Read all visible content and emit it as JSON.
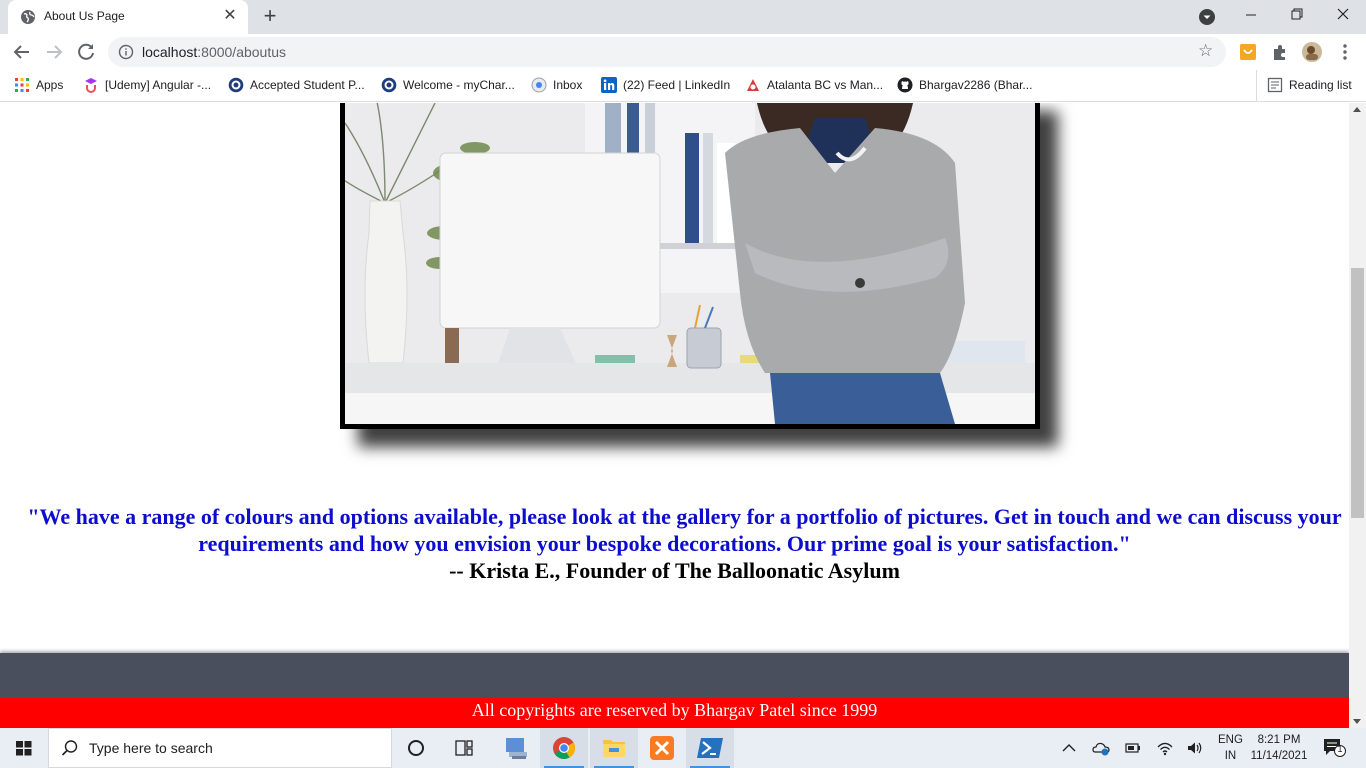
{
  "browser": {
    "tab": {
      "title": "About Us Page"
    },
    "url": {
      "host": "localhost",
      "path": ":8000/aboutus"
    },
    "bookmarks": [
      {
        "label": "Apps",
        "icon": "apps-grid-icon"
      },
      {
        "label": "[Udemy] Angular -...",
        "icon": "udemy-icon"
      },
      {
        "label": "Accepted Student P...",
        "icon": "university-icon"
      },
      {
        "label": "Welcome - myChar...",
        "icon": "university-icon"
      },
      {
        "label": "Inbox",
        "icon": "mail-icon"
      },
      {
        "label": "(22) Feed | LinkedIn",
        "icon": "linkedin-icon"
      },
      {
        "label": "Atalanta BC vs Man...",
        "icon": "sports-icon"
      },
      {
        "label": "Bhargav2286 (Bhar...",
        "icon": "github-icon"
      }
    ],
    "reading_list": "Reading list"
  },
  "page": {
    "photo_alt": "Founder standing with arms crossed beside a desk with a computer",
    "quote": "\"We have a range of colours and options available, please look at the gallery for a portfolio of pictures. Get in touch and we can discuss your requirements and how you envision your bespoke decorations. Our prime goal is your satisfaction.\"",
    "author": "-- Krista E., Founder of The Balloonatic Asylum",
    "footer": "All copyrights are reserved by Bhargav Patel since 1999",
    "colors": {
      "quote": "#0d0dce",
      "footer_band": "#4a4f5e",
      "footer_bar": "#ff0000"
    }
  },
  "taskbar": {
    "search_placeholder": "Type here to search",
    "lang_top": "ENG",
    "lang_bottom": "IN",
    "time": "8:21 PM",
    "date": "11/14/2021",
    "notification_count": "1"
  }
}
